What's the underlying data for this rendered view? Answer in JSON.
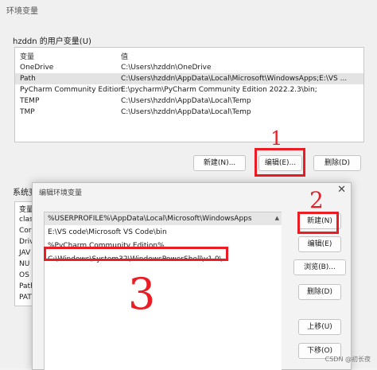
{
  "window": {
    "title": "环境变量"
  },
  "user_vars": {
    "group_label": "hzddn 的用户变量(U)",
    "columns": [
      "变量",
      "值"
    ],
    "rows": [
      {
        "name": "OneDrive",
        "value": "C:\\Users\\hzddn\\OneDrive"
      },
      {
        "name": "Path",
        "value": "C:\\Users\\hzddn\\AppData\\Local\\Microsoft\\WindowsApps;E:\\VS ..."
      },
      {
        "name": "PyCharm Community Edition",
        "value": "E:\\pycharm\\PyCharm Community Edition 2022.2.3\\bin;"
      },
      {
        "name": "TEMP",
        "value": "C:\\Users\\hzddn\\AppData\\Local\\Temp"
      },
      {
        "name": "TMP",
        "value": "C:\\Users\\hzddn\\AppData\\Local\\Temp"
      }
    ],
    "buttons": {
      "new": "新建(N)...",
      "edit": "编辑(E)...",
      "delete": "删除(D)"
    }
  },
  "sys_vars": {
    "group_label": "系统变",
    "column": "变量",
    "rows": [
      "clas",
      "Cor",
      "Driv",
      "JAV",
      "NU",
      "OS",
      "Path",
      "PAT"
    ]
  },
  "edit_dialog": {
    "title": "编辑环境变量",
    "close": "✕",
    "paths": [
      "%USERPROFILE%\\AppData\\Local\\Microsoft\\WindowsApps",
      "E:\\VS code\\Microsoft VS Code\\bin",
      "%PyCharm Community Edition%",
      "C:\\Windows\\System32\\WindowsPowerShell\\v1.0\\"
    ],
    "buttons": {
      "new": "新建(N)",
      "edit": "编辑(E)",
      "browse": "浏览(B)...",
      "delete": "删除(D)",
      "up": "上移(U)",
      "down": "下移(O)"
    }
  },
  "annotations": {
    "one": "1",
    "two": "2",
    "three": "3",
    "color": "#ea1c24"
  },
  "watermark": "CSDN @初长夜"
}
